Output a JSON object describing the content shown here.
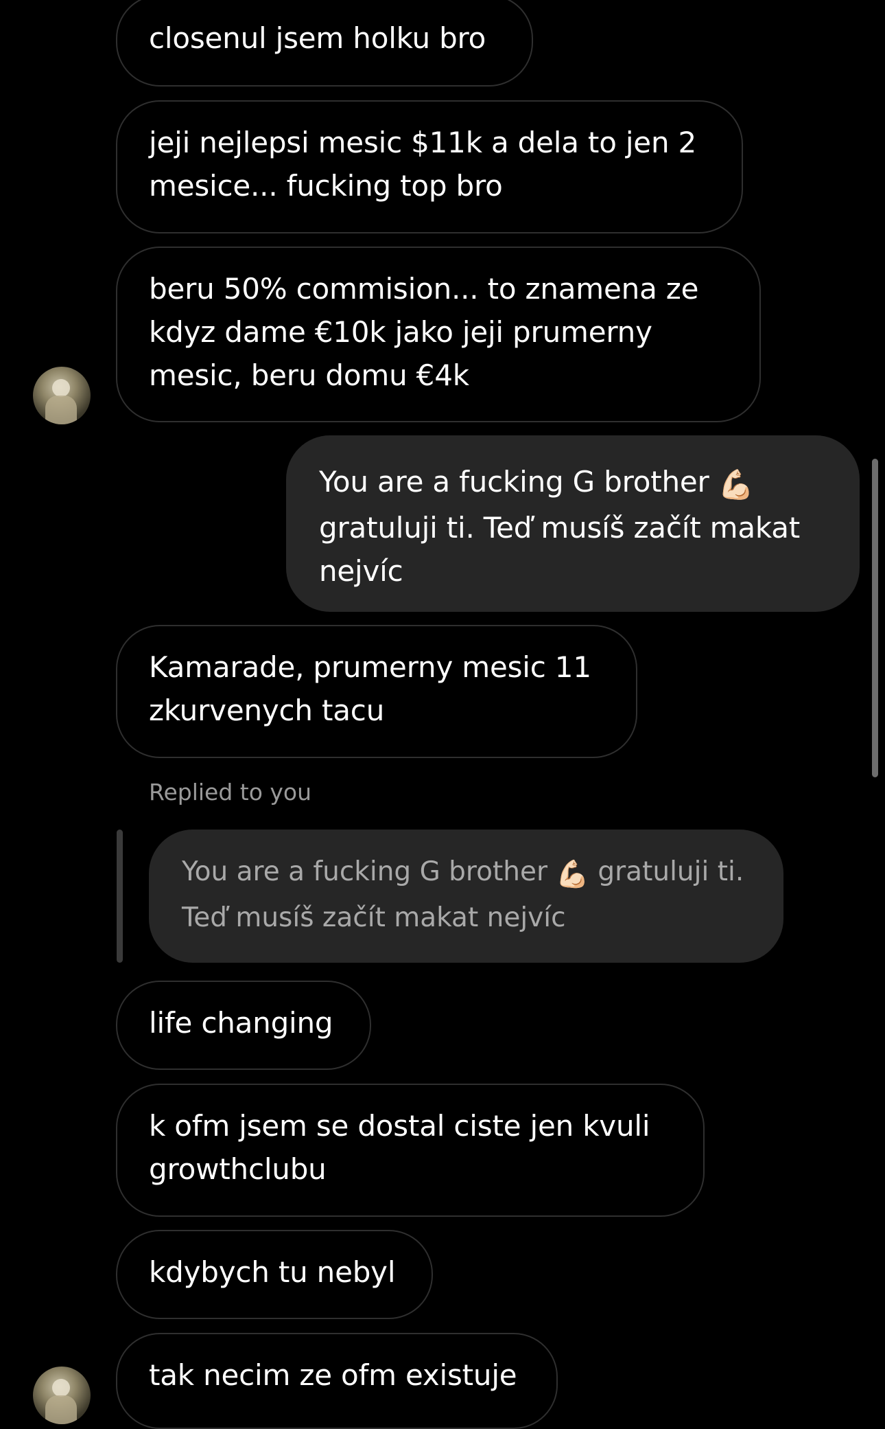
{
  "messages": [
    {
      "side": "incoming",
      "lines": [
        "closenul jsem holku bro"
      ]
    },
    {
      "side": "incoming",
      "lines": [
        "jeji nejlepsi mesic $11k a dela to jen 2",
        "mesice... fucking top bro"
      ]
    },
    {
      "side": "incoming",
      "lines": [
        "beru 50% commision... to znamena ze",
        "kdyz dame €10k jako jeji prumerny",
        "mesic, beru domu €4k"
      ]
    },
    {
      "side": "outgoing",
      "line1": "You are a fucking G brother ",
      "emoji": "💪🏻",
      "line2": "gratuluji ti. Teď musíš začít makat",
      "line3": "nejvíc"
    },
    {
      "side": "incoming",
      "lines": [
        "Kamarade, prumerny mesic 11",
        "zkurvenych tacu"
      ]
    },
    {
      "side": "incoming",
      "lines": [
        "life changing"
      ]
    },
    {
      "side": "incoming",
      "lines": [
        "k ofm jsem se dostal ciste jen kvuli",
        "growthclubu"
      ]
    },
    {
      "side": "incoming",
      "lines": [
        "kdybych tu nebyl"
      ]
    },
    {
      "side": "incoming",
      "lines": [
        "tak necim ze ofm existuje"
      ]
    }
  ],
  "reply": {
    "label": "Replied to you",
    "quote_part1": "You are a fucking G brother ",
    "emoji": "💪🏻",
    "quote_part2": " gratuluji ti.",
    "quote_line2": "Teď musíš začít makat nejvíc"
  },
  "icons": {
    "avatar": "profile-photo",
    "reply": "reply-indicator-bar",
    "scroll": "scrollbar-thumb"
  },
  "colors": {
    "background": "#000000",
    "outgoing_bubble": "#262626",
    "incoming_border": "#2f2f2f",
    "muted_text": "#9a9a9a"
  }
}
